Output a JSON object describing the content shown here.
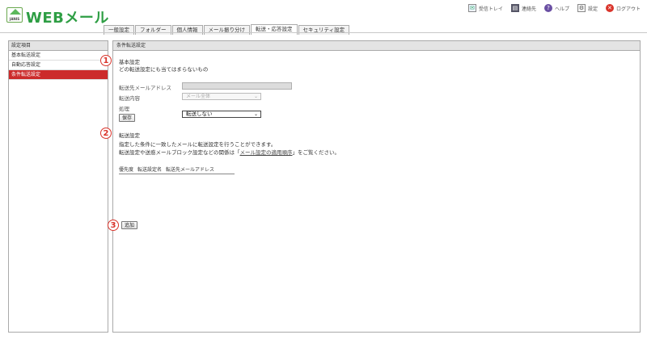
{
  "header": {
    "logo_text": "JANIS",
    "brand": "WEBメール",
    "links": [
      {
        "icon": "inbox-icon",
        "glyph": "✉",
        "label": "受信トレイ"
      },
      {
        "icon": "address-book-icon",
        "glyph": "▤",
        "label": "連絡先"
      },
      {
        "icon": "help-icon",
        "glyph": "?",
        "label": "ヘルプ"
      },
      {
        "icon": "settings-icon",
        "glyph": "⚙",
        "label": "設定"
      },
      {
        "icon": "logout-icon",
        "glyph": "✕",
        "label": "ログアウト"
      }
    ]
  },
  "tabs": [
    {
      "label": "一般設定",
      "active": false
    },
    {
      "label": "フォルダー",
      "active": false
    },
    {
      "label": "個人情報",
      "active": false
    },
    {
      "label": "メール振り分け",
      "active": false
    },
    {
      "label": "転送・応答設定",
      "active": true
    },
    {
      "label": "セキュリティ設定",
      "active": false
    }
  ],
  "sidebar": {
    "heading": "設定項目",
    "items": [
      {
        "label": "基本転送設定",
        "active": false
      },
      {
        "label": "自動応答設定",
        "active": false
      },
      {
        "label": "条件転送設定",
        "active": true
      }
    ]
  },
  "main": {
    "heading": "条件転送設定",
    "callouts": [
      "1",
      "2",
      "3"
    ],
    "basic": {
      "title": "基本設定",
      "desc": "どの転送設定にも当てはまらないもの",
      "address_label": "転送先メールアドレス",
      "address_value": "",
      "content_label": "転送内容",
      "content_value": "メール全体",
      "action_label": "処理",
      "action_value": "転送しない",
      "save_label": "保存"
    },
    "forward": {
      "title": "転送設定",
      "desc1": "指定した条件に一致したメールに転送設定を行うことができます。",
      "desc2_pre": "転送設定や送惑メールブロック設定などの関係は「",
      "desc2_link": "メール設定の適用順序",
      "desc2_post": "」をご覧ください。",
      "columns": [
        "優先度",
        "転送設定名",
        "転送先メールアドレス"
      ],
      "add_label": "追加"
    }
  }
}
